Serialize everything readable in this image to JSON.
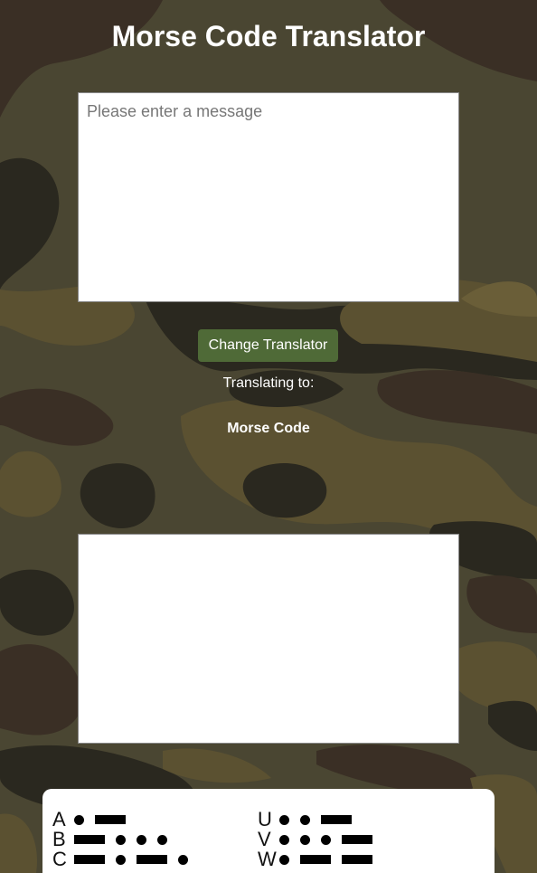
{
  "header": {
    "title": "Morse Code Translator"
  },
  "input": {
    "placeholder": "Please enter a message",
    "value": ""
  },
  "controls": {
    "change_button_label": "Change Translator",
    "translating_label": "Translating to:",
    "target_language": "Morse Code"
  },
  "output": {
    "value": ""
  },
  "chart": {
    "left_column": [
      {
        "letter": "A",
        "code": ".-"
      },
      {
        "letter": "B",
        "code": "-..."
      },
      {
        "letter": "C",
        "code": "-.-."
      }
    ],
    "right_column": [
      {
        "letter": "U",
        "code": "..-"
      },
      {
        "letter": "V",
        "code": "...-"
      },
      {
        "letter": "W",
        "code": ".--"
      }
    ]
  },
  "colors": {
    "button": "#4f6a37",
    "camo_dark": "#2a281f",
    "camo_brown": "#3a2f25",
    "camo_olive": "#5b5131",
    "camo_green": "#46452c"
  }
}
